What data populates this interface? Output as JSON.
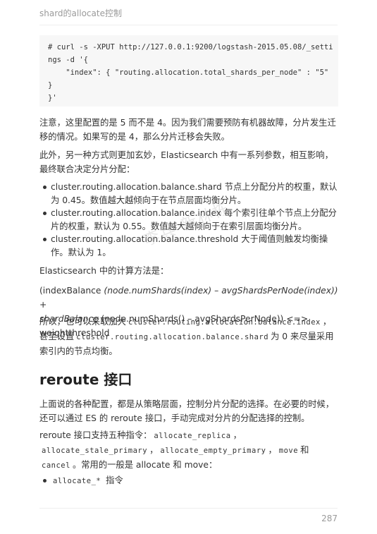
{
  "header": {
    "title": "shard的allocate控制"
  },
  "code": {
    "line1": "# curl -s -XPUT http://127.0.0.1:9200/logstash-2015.05.08/_setti",
    "line2": "ngs -d '{",
    "line3": "    \"index\": { \"routing.allocation.total_shards_per_node\" : \"5\"",
    "line4": "}",
    "line5": "}'"
  },
  "para1": "注意，这里配置的是 5 而不是 4。因为我们需要预防有机器故障，分片发生迁移的情况。如果写的是 4，那么分片迁移会失败。",
  "para2": "此外，另一种方式则更加玄妙，Elasticsearch 中有一系列参数，相互影响，最终联合决定分片分配：",
  "bullets": [
    "cluster.routing.allocation.balance.shard 节点上分配分片的权重，默认为 0.45。数值越大越倾向于在节点层面均衡分片。",
    "cluster.routing.allocation.balance.index 每个索引往单个节点上分配分片的权重，默认为 0.55。数值越大越倾向于在索引层面均衡分片。",
    "cluster.routing.allocation.balance.threshold 大于阈值则触发均衡操作。默认为 1。"
  ],
  "para3": "Elasticsearch 中的计算方法是：",
  "formula": {
    "part1": "(indexBalance ",
    "part2": "(node.numShards(index) – avgShardsPerNode(index)) +",
    "part3": "shardBalance",
    "part4": " (node.numShards() – avgShardsPerNode)) <=> weightthreshold"
  },
  "para4": {
    "t1": "所以，也可以采取加大",
    "c1": "cluster.routing.allocation.balance.index",
    "t2": "，甚至设置",
    "c2": "cluster.routing.allocation.balance.shard",
    "t3": "为 0 来尽量采用索引内的节点均衡。"
  },
  "heading": "reroute 接口",
  "para5": "上面说的各种配置，都是从策略层面，控制分片分配的选择。在必要的时候，还可以通过 ES 的 reroute 接口，手动完成对分片的分配选择的控制。",
  "para6": {
    "t1": "reroute 接口支持五种指令：",
    "c1": "allocate_replica",
    "s1": "，",
    "c2": "allocate_stale_primary",
    "s2": "，",
    "c3": "allocate_empty_primary",
    "s3": "，",
    "c4": "move",
    "s4": "和",
    "c5": "cancel",
    "t2": "。常用的一般是 allocate 和 move："
  },
  "bullet_last": {
    "code": "allocate_*",
    "text": "指令"
  },
  "watermark": "李兵 新林栋",
  "page_number": "287"
}
